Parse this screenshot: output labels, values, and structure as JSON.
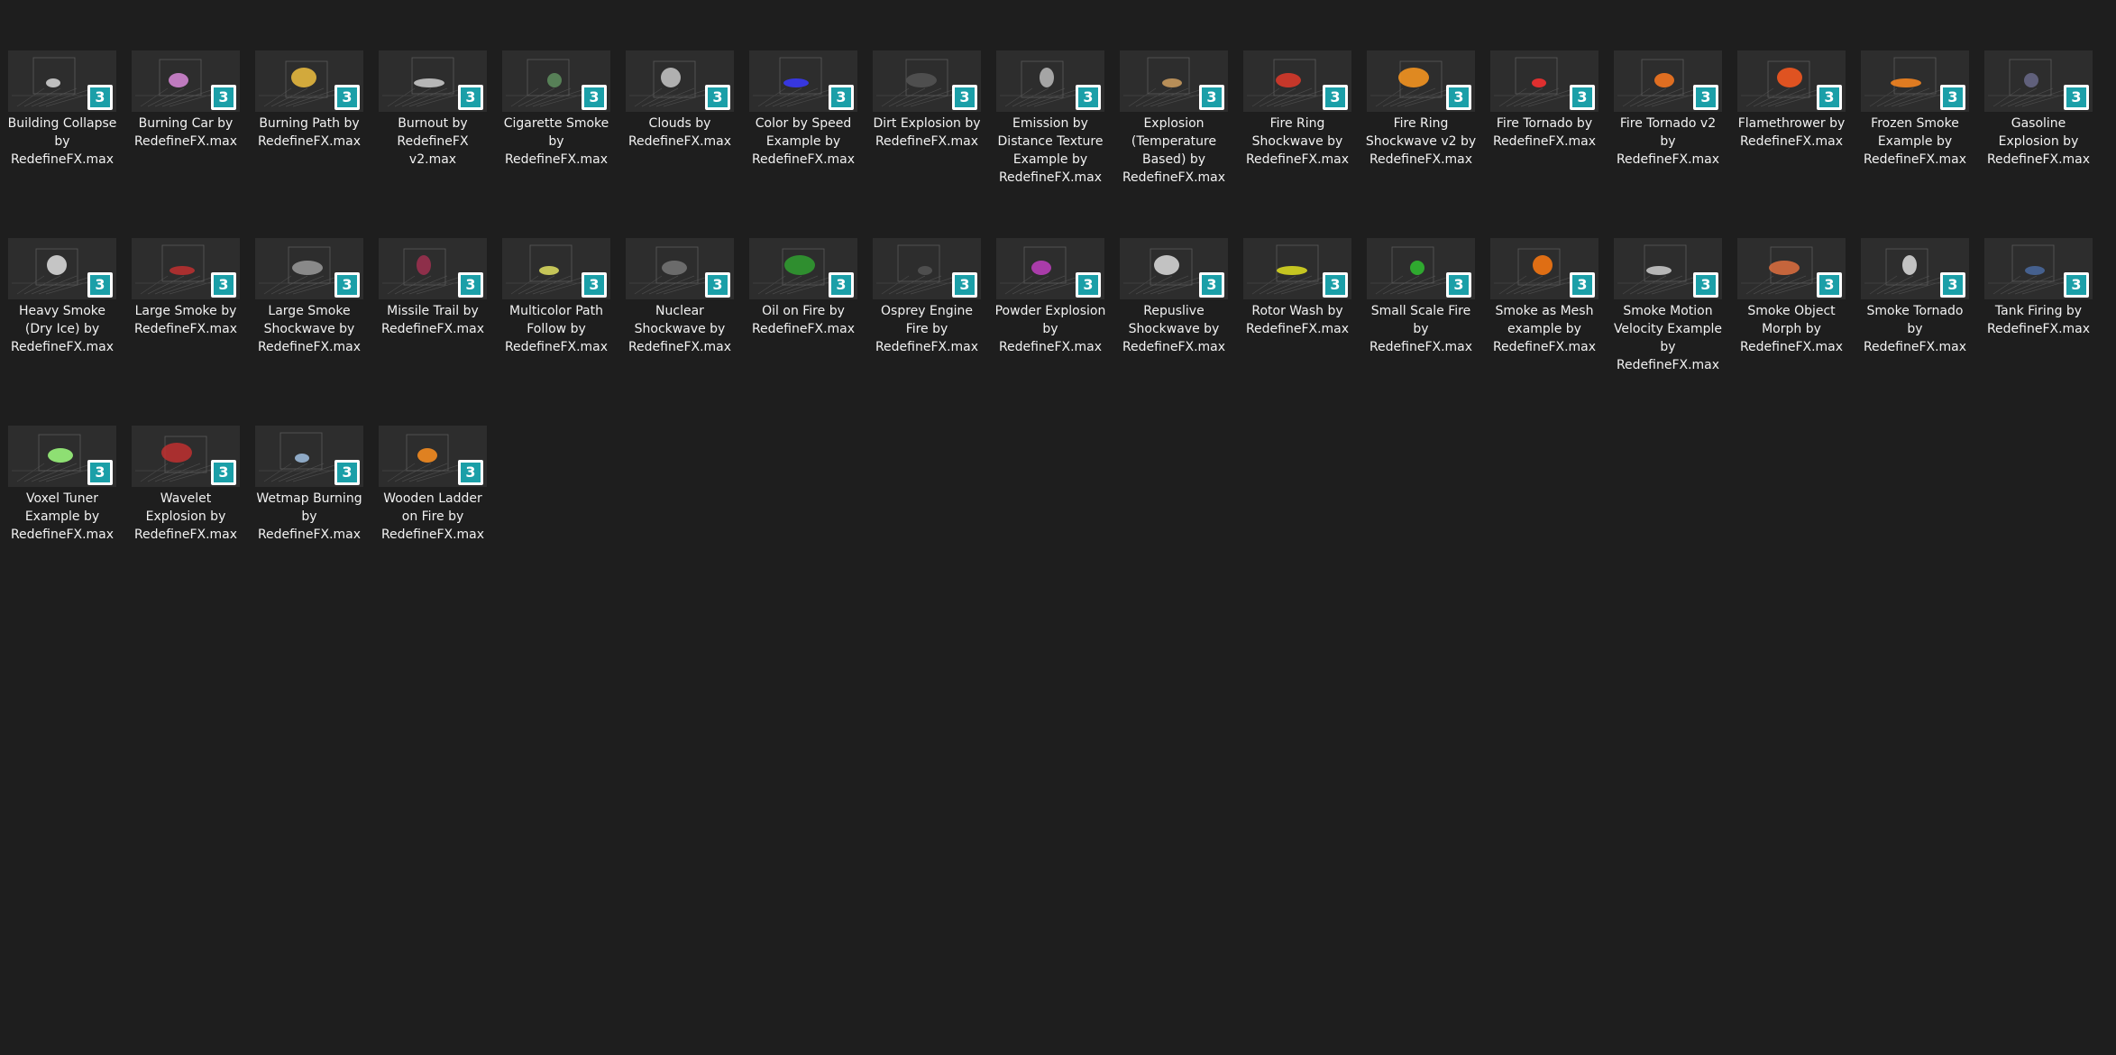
{
  "badge_text": "3",
  "files": [
    {
      "name": "Building Collapse by RedefineFX.max",
      "accent": "#d8d8d8"
    },
    {
      "name": "Burning Car by RedefineFX.max",
      "accent": "#d98ad9"
    },
    {
      "name": "Burning Path by RedefineFX.max",
      "accent": "#f0c040"
    },
    {
      "name": "Burnout by RedefineFX v2.max",
      "accent": "#cfcfcf"
    },
    {
      "name": "Cigarette Smoke by RedefineFX.max",
      "accent": "#5f8f5f"
    },
    {
      "name": "Clouds by RedefineFX.max",
      "accent": "#c8c8c8"
    },
    {
      "name": "Color by Speed Example by RedefineFX.max",
      "accent": "#3a3aff"
    },
    {
      "name": "Dirt Explosion by RedefineFX.max",
      "accent": "#555555"
    },
    {
      "name": "Emission by Distance Texture Example by RedefineFX.max",
      "accent": "#bbbbbb"
    },
    {
      "name": "Explosion (Temperature Based) by RedefineFX.max",
      "accent": "#d0a060"
    },
    {
      "name": "Fire Ring Shockwave by RedefineFX.max",
      "accent": "#e03a2a"
    },
    {
      "name": "Fire Ring Shockwave v2 by RedefineFX.max",
      "accent": "#ff9a20"
    },
    {
      "name": "Fire Tornado by RedefineFX.max",
      "accent": "#ff3030"
    },
    {
      "name": "Fire Tornado v2 by RedefineFX.max",
      "accent": "#ff7a20"
    },
    {
      "name": "Flamethrower by RedefineFX.max",
      "accent": "#ff5a20"
    },
    {
      "name": "Frozen Smoke Example by RedefineFX.max",
      "accent": "#ff8a20"
    },
    {
      "name": "Gasoline Explosion by RedefineFX.max",
      "accent": "#6a6a8a"
    },
    {
      "name": "Heavy Smoke (Dry Ice) by RedefineFX.max",
      "accent": "#e0e0e0"
    },
    {
      "name": "Large Smoke by RedefineFX.max",
      "accent": "#c03030"
    },
    {
      "name": "Large Smoke Shockwave by RedefineFX.max",
      "accent": "#9a9a9a"
    },
    {
      "name": "Missile Trail by RedefineFX.max",
      "accent": "#a03050"
    },
    {
      "name": "Multicolor Path Follow by RedefineFX.max",
      "accent": "#e0e060"
    },
    {
      "name": "Nuclear Shockwave by RedefineFX.max",
      "accent": "#777777"
    },
    {
      "name": "Oil on Fire by RedefineFX.max",
      "accent": "#30a030"
    },
    {
      "name": "Osprey Engine Fire by RedefineFX.max",
      "accent": "#555555"
    },
    {
      "name": "Powder Explosion by RedefineFX.max",
      "accent": "#c040c0"
    },
    {
      "name": "Repuslive Shockwave by RedefineFX.max",
      "accent": "#dddddd"
    },
    {
      "name": "Rotor Wash by RedefineFX.max",
      "accent": "#e0e020"
    },
    {
      "name": "Small Scale Fire by RedefineFX.max",
      "accent": "#30c030"
    },
    {
      "name": "Smoke as Mesh example by RedefineFX.max",
      "accent": "#ff7a10"
    },
    {
      "name": "Smoke Motion Velocity Example by RedefineFX.max",
      "accent": "#cfcfcf"
    },
    {
      "name": "Smoke Object Morph by RedefineFX.max",
      "accent": "#e07040"
    },
    {
      "name": "Smoke Tornado by RedefineFX.max",
      "accent": "#dddddd"
    },
    {
      "name": "Tank Firing by RedefineFX.max",
      "accent": "#4a6aa0"
    },
    {
      "name": "Voxel Tuner Example by RedefineFX.max",
      "accent": "#a0ff80"
    },
    {
      "name": "Wavelet Explosion by RedefineFX.max",
      "accent": "#c03030"
    },
    {
      "name": "Wetmap Burning by RedefineFX.max",
      "accent": "#a0c0e0"
    },
    {
      "name": "Wooden Ladder on Fire by RedefineFX.max",
      "accent": "#ff9020"
    }
  ]
}
